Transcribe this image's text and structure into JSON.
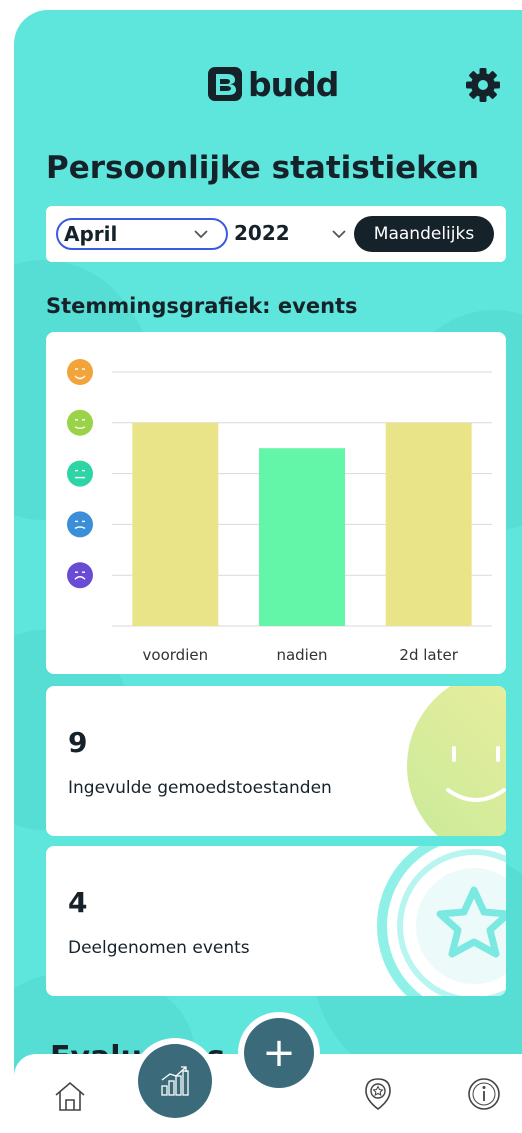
{
  "header": {
    "logo_text": "budd",
    "settings_icon": "gear-icon"
  },
  "page": {
    "title": "Persoonlijke statistieken"
  },
  "filters": {
    "month": "April",
    "year": "2022",
    "period_button": "Maandelijks"
  },
  "mood_chart": {
    "section_title": "Stemmingsgrafiek: events",
    "mood_levels": [
      "very-happy-face",
      "happy-face",
      "neutral-face",
      "sad-face",
      "very-sad-face"
    ],
    "mood_colors": [
      "#f2a43a",
      "#9ad24a",
      "#2dd4a6",
      "#3a8fd8",
      "#6a4bd6"
    ]
  },
  "chart_data": {
    "type": "bar",
    "categories": [
      "voordien",
      "nadien",
      "2d later"
    ],
    "values": [
      4,
      3.5,
      4
    ],
    "ylim": [
      0,
      5
    ],
    "y_scale_labels": [
      "very-sad",
      "sad",
      "neutral",
      "happy",
      "very-happy"
    ],
    "grid": true,
    "bar_colors": [
      "#e8e487",
      "#63f5a8",
      "#e8e487"
    ]
  },
  "stats": [
    {
      "number": "9",
      "label": "Ingevulde gemoedstoestanden",
      "decoration": "smiley-decoration"
    },
    {
      "number": "4",
      "label": "Deelgenomen events",
      "decoration": "star-badge-decoration"
    }
  ],
  "next_section_peek": "Evaluaties",
  "nav": {
    "items": [
      "home-icon",
      "stats-icon",
      "add-icon",
      "badge-icon",
      "info-icon"
    ]
  }
}
